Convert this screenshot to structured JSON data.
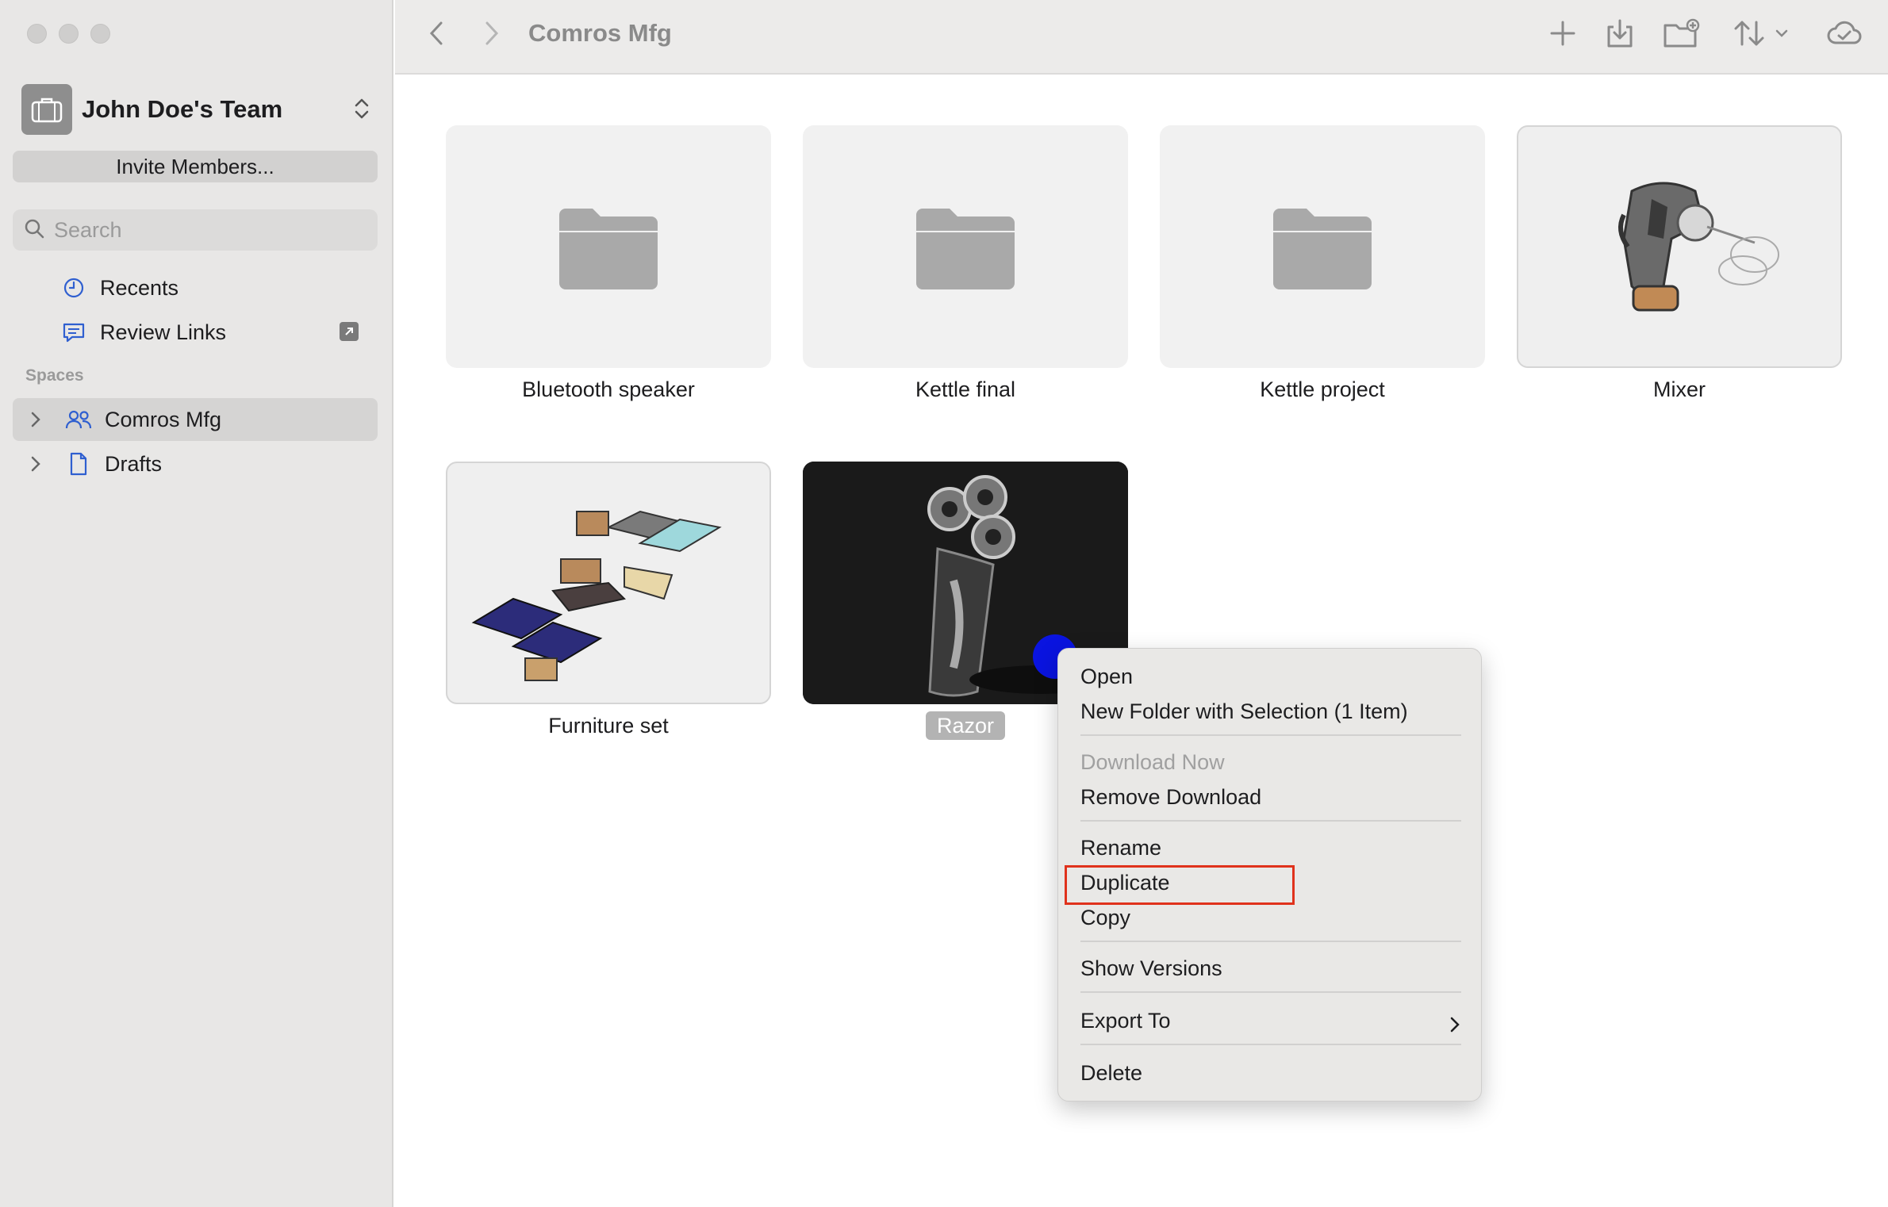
{
  "sidebar": {
    "team_name": "John Doe's Team",
    "invite_label": "Invite Members...",
    "search_placeholder": "Search",
    "items": {
      "recents": "Recents",
      "review_links": "Review Links"
    },
    "spaces_header": "Spaces",
    "spaces": {
      "comros": "Comros Mfg",
      "drafts": "Drafts"
    }
  },
  "toolbar": {
    "title": "Comros Mfg"
  },
  "tiles": {
    "bluetooth": "Bluetooth speaker",
    "kettle_final": "Kettle final",
    "kettle_project": "Kettle project",
    "mixer": "Mixer",
    "furniture": "Furniture set",
    "razor": "Razor"
  },
  "context_menu": {
    "open": "Open",
    "new_folder": "New Folder with Selection (1 Item)",
    "download_now": "Download Now",
    "remove_download": "Remove Download",
    "rename": "Rename",
    "duplicate": "Duplicate",
    "copy": "Copy",
    "show_versions": "Show Versions",
    "export_to": "Export To",
    "delete": "Delete"
  },
  "colors": {
    "accent_blue": "#2f5fd0",
    "highlight_red": "#e0321c",
    "cursor_blue": "#0a14e0"
  }
}
